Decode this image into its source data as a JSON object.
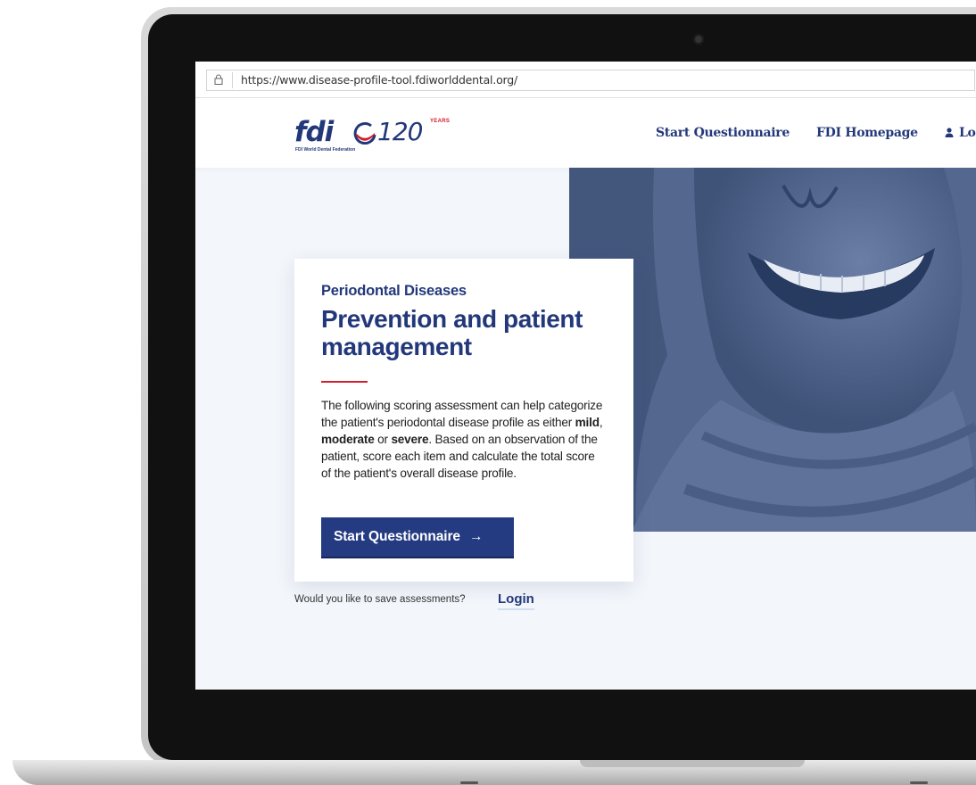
{
  "browser": {
    "url": "https://www.disease-profile-tool.fdiworlddental.org/",
    "lock_icon": "lock-icon"
  },
  "header": {
    "logo": {
      "wordmark": "fdi",
      "anniversary": "120",
      "years_label": "YEARS",
      "subtitle": "FDI World Dental Federation"
    },
    "nav": {
      "start": "Start Questionnaire",
      "home": "FDI Homepage",
      "login": "Lo"
    }
  },
  "hero": {
    "eyebrow": "Periodontal Diseases",
    "headline": "Prevention and patient management",
    "body": {
      "p1": "The following scoring assessment can help categorize the patient's periodontal disease profile as either ",
      "mild": "mild",
      "comma": ", ",
      "moderate": "moderate",
      "or": " or ",
      "severe": "severe",
      "p2": ". Based on an observation of the patient, score each item and calculate the total score of the patient's overall disease profile."
    },
    "cta_label": "Start Questionnaire",
    "cta_arrow": "→"
  },
  "footer_prompt": {
    "question": "Would you like to save assessments?",
    "login": "Login"
  },
  "colors": {
    "brand_navy": "#22387a",
    "accent_red": "#d11f2b",
    "photo_tint": "#43577d",
    "page_bg": "#f3f6fb"
  }
}
